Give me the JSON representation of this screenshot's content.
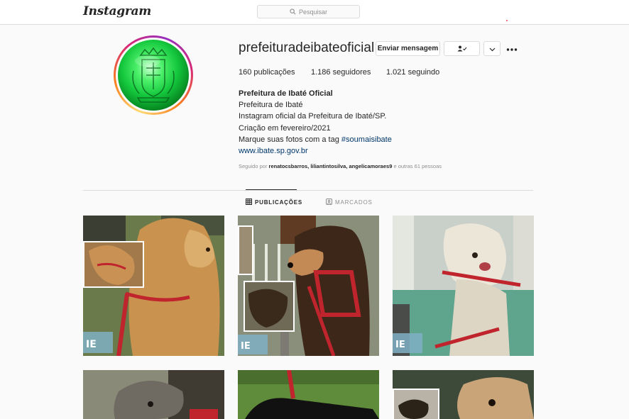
{
  "nav": {
    "logo": "Instagram",
    "search_placeholder": "Pesquisar",
    "logo_icon": "instagram-wordmark",
    "search_icon": "search-icon"
  },
  "profile": {
    "username": "prefeituradeibateoficial",
    "message_button": "Enviar mensagem",
    "follow_icon": "person-check-icon",
    "more_icon": "more-horizontal-icon",
    "stats": [
      {
        "count": "160",
        "label": "publicações"
      },
      {
        "count": "1.186",
        "label": "seguidores"
      },
      {
        "count": "1.021",
        "label": "seguindo"
      }
    ],
    "bio": {
      "name": "Prefeitura de Ibaté Oficial",
      "category": "Prefeitura de Ibaté",
      "line1": "Instagram oficial da Prefeitura de Ibaté/SP.",
      "line2": "Criação em fevereiro/2021",
      "line3_prefix": "Marque suas fotos com a tag ",
      "hashtag": "#soumaisibate",
      "website": "www.ibate.sp.gov.br"
    },
    "followed_by": {
      "prefix": "Seguido por ",
      "users": "renatocsbarros, liliantintosilva, angelicamoraes9",
      "suffix": " e outras 61 pessoas"
    }
  },
  "tabs": [
    {
      "label": "PUBLICAÇÕES",
      "icon": "grid-icon",
      "active": true
    },
    {
      "label": "MARCADOS",
      "icon": "tagged-icon",
      "active": false
    }
  ],
  "colors": {
    "accent_link": "#00376b",
    "border": "#dbdbdb",
    "background": "#fafafa",
    "avatar_green": "#14c83d"
  }
}
